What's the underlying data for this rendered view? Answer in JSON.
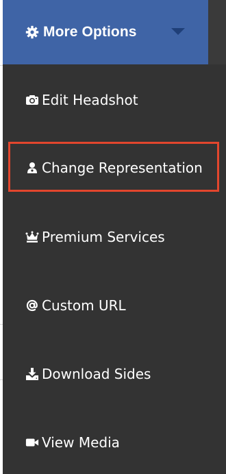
{
  "menu": {
    "header": {
      "title": "More Options",
      "icon": "gear-icon",
      "caret_icon": "caret-down-icon",
      "background": "#3f64a6"
    },
    "items": [
      {
        "label": "Edit Headshot",
        "icon": "camera-icon"
      },
      {
        "label": "Change Representation",
        "icon": "user-icon",
        "highlighted": true
      },
      {
        "label": "Premium Services",
        "icon": "crown-icon"
      },
      {
        "label": "Custom URL",
        "icon": "at-sign-icon"
      },
      {
        "label": "Download Sides",
        "icon": "download-icon"
      },
      {
        "label": "View Media",
        "icon": "video-camera-icon"
      }
    ],
    "background": "#333333",
    "highlight_color": "#e3462d"
  }
}
